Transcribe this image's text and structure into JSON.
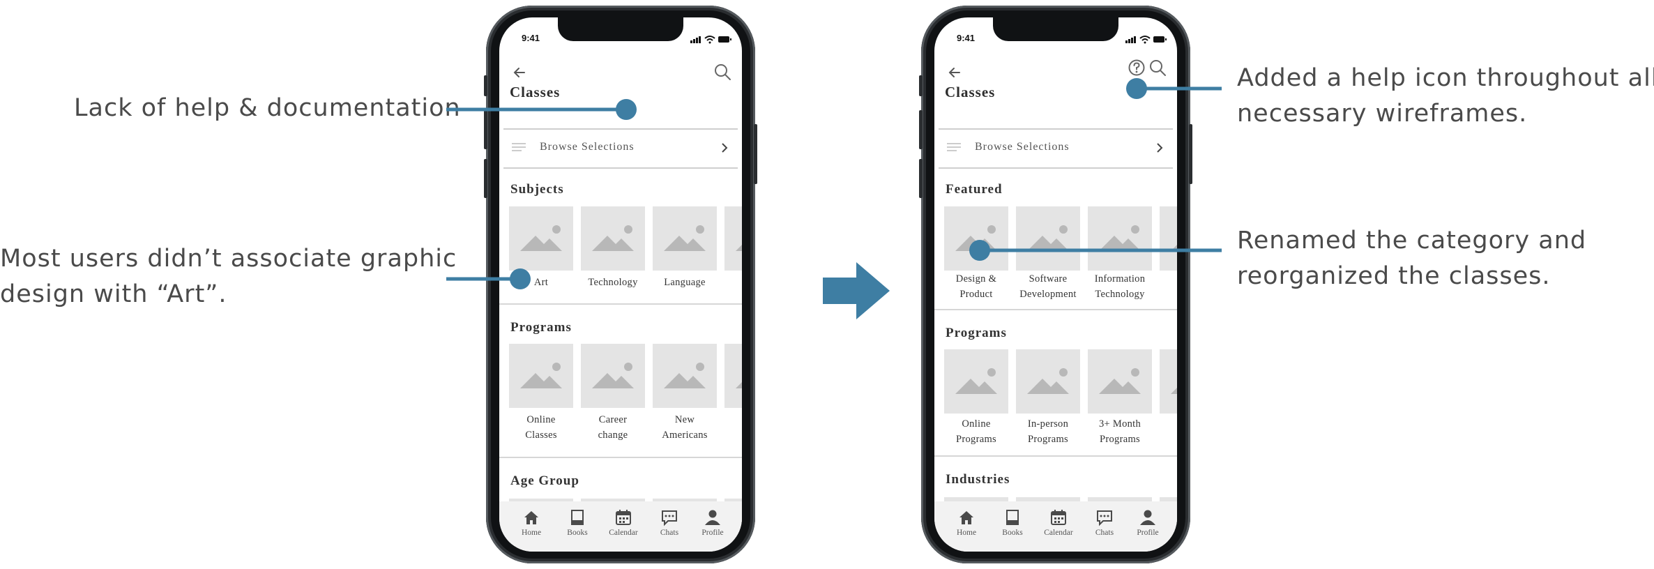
{
  "annotations": {
    "left_1": "Lack of help & documentation",
    "left_2_line1": "Most users didn’t associate graphic",
    "left_2_line2": "design with “Art”.",
    "right_1_line1": "Added a help icon throughout all",
    "right_1_line2": "necessary wireframes.",
    "right_2_line1": "Renamed the category and",
    "right_2_line2": "reorganized the classes."
  },
  "colors": {
    "accent": "#3e7ea3",
    "tile": "#e4e4e4",
    "placeholder_icon": "#b8b8b8"
  },
  "before": {
    "status_time": "9:41",
    "title": "Classes",
    "browse": "Browse Selections",
    "section1": {
      "title": "Subjects",
      "tiles": [
        {
          "line1": "Art",
          "line2": ""
        },
        {
          "line1": "Technology",
          "line2": ""
        },
        {
          "line1": "Language",
          "line2": ""
        }
      ]
    },
    "section2": {
      "title": "Programs",
      "tiles": [
        {
          "line1": "Online",
          "line2": "Classes"
        },
        {
          "line1": "Career",
          "line2": "change"
        },
        {
          "line1": "New",
          "line2": "Americans"
        }
      ]
    },
    "section3": {
      "title": "Age Group"
    },
    "tabs": [
      "Home",
      "Books",
      "Calendar",
      "Chats",
      "Profile"
    ]
  },
  "after": {
    "status_time": "9:41",
    "title": "Classes",
    "browse": "Browse Selections",
    "section1": {
      "title": "Featured",
      "tiles": [
        {
          "line1": "Design &",
          "line2": "Product"
        },
        {
          "line1": "Software",
          "line2": "Development"
        },
        {
          "line1": "Information",
          "line2": "Technology"
        }
      ]
    },
    "section2": {
      "title": "Programs",
      "tiles": [
        {
          "line1": "Online",
          "line2": "Programs"
        },
        {
          "line1": "In-person",
          "line2": "Programs"
        },
        {
          "line1": "3+ Month",
          "line2": "Programs"
        }
      ]
    },
    "section3": {
      "title": "Industries"
    },
    "tabs": [
      "Home",
      "Books",
      "Calendar",
      "Chats",
      "Profile"
    ]
  },
  "icons": {
    "back": "back-arrow-icon",
    "search": "search-icon",
    "help": "help-icon",
    "browse": "list-icon",
    "chevron": "chevron-right-icon",
    "transition": "right-arrow-icon",
    "tabs": [
      "home-icon",
      "book-icon",
      "calendar-icon",
      "chat-icon",
      "profile-icon"
    ]
  }
}
